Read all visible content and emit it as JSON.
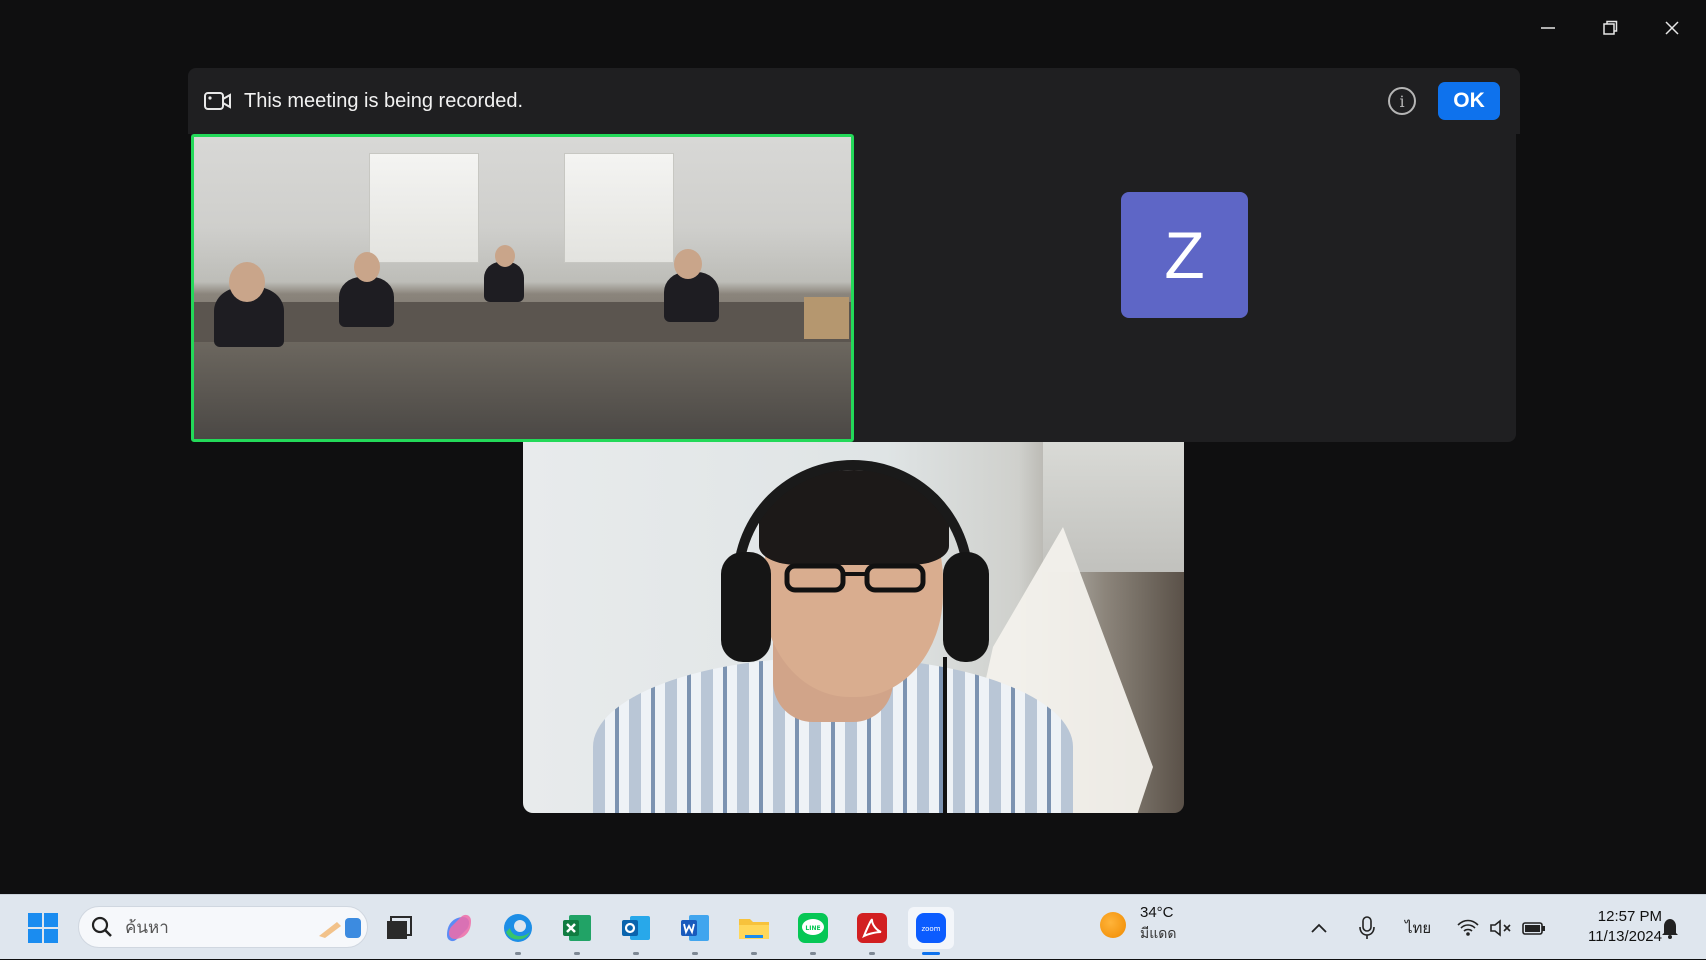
{
  "window": {
    "controls": [
      "minimize",
      "restore",
      "close"
    ]
  },
  "recording_banner": {
    "text": "This meeting is being recorded.",
    "ok_label": "OK"
  },
  "participant_avatar": {
    "letter": "Z",
    "color": "#5e66c6"
  },
  "active_speaker_border": "#23d959",
  "taskbar": {
    "search_placeholder": "ค้นหา",
    "weather": {
      "temp": "34°C",
      "condition": "มีแดด"
    },
    "language": "ไทย",
    "time": "12:57 PM",
    "date": "11/13/2024",
    "apps": [
      "start-icon",
      "task-view-icon",
      "copilot-icon",
      "edge-icon",
      "excel-icon",
      "outlook-icon",
      "word-icon",
      "file-explorer-icon",
      "line-icon",
      "acrobat-icon",
      "zoom-icon"
    ]
  }
}
